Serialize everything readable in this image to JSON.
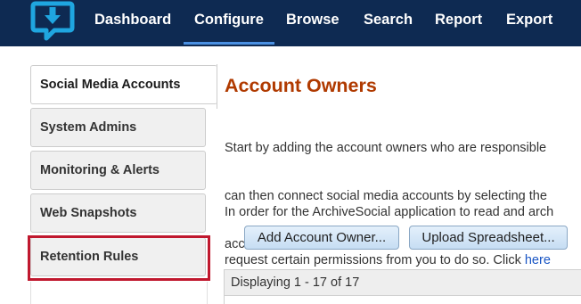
{
  "nav": {
    "logo_icon": "chat-bubble-download-icon",
    "items": [
      {
        "label": "Dashboard"
      },
      {
        "label": "Configure"
      },
      {
        "label": "Browse"
      },
      {
        "label": "Search"
      },
      {
        "label": "Report"
      },
      {
        "label": "Export"
      }
    ],
    "active": "Configure"
  },
  "sidebar": {
    "tabs": [
      {
        "label": "Social Media Accounts"
      },
      {
        "label": "System Admins"
      },
      {
        "label": "Monitoring & Alerts"
      },
      {
        "label": "Web Snapshots"
      },
      {
        "label": "Retention Rules"
      }
    ],
    "active": "Social Media Accounts",
    "highlighted": "Retention Rules"
  },
  "main": {
    "title": "Account Owners",
    "para1": [
      "Start by adding the account owners who are responsible",
      "can then connect social media accounts by selecting the",
      "account owner."
    ],
    "para2": [
      "In order for the ArchiveSocial application to read and arch",
      "request certain permissions from you to do so. Click "
    ],
    "para2_link": "here",
    "buttons": {
      "add_owner": "Add Account Owner...",
      "upload": "Upload Spreadsheet..."
    },
    "grid_status": "Displaying 1 - 17 of 17"
  },
  "colors": {
    "nav_bg": "#0e2a52",
    "nav_active_underline": "#4a90e2",
    "title": "#b03a00",
    "highlight": "#c0182e",
    "link": "#1a56c4"
  }
}
